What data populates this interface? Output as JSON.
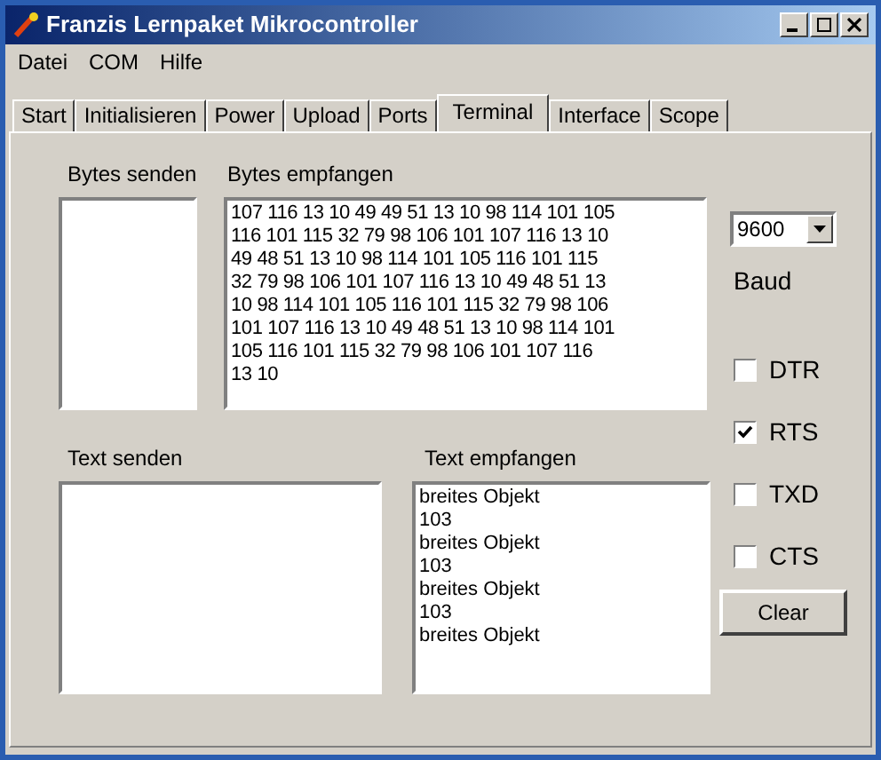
{
  "window": {
    "title": "Franzis Lernpaket Mikrocontroller"
  },
  "menu": [
    "Datei",
    "COM",
    "Hilfe"
  ],
  "tabs": [
    {
      "label": "Start",
      "selected": false
    },
    {
      "label": "Initialisieren",
      "selected": false
    },
    {
      "label": "Power",
      "selected": false
    },
    {
      "label": "Upload",
      "selected": false
    },
    {
      "label": "Ports",
      "selected": false
    },
    {
      "label": "Terminal",
      "selected": true
    },
    {
      "label": "Interface",
      "selected": false
    },
    {
      "label": "Scope",
      "selected": false
    }
  ],
  "bytes_send": {
    "label": "Bytes senden"
  },
  "bytes_received": {
    "label": "Bytes empfangen",
    "lines": [
      "107 116 13 10 49 49 51 13 10 98 114 101 105",
      "116 101 115 32 79 98 106 101 107 116 13 10",
      "49 48 51 13 10 98 114 101 105 116 101 115",
      "32 79 98 106 101 107 116 13 10 49 48 51 13",
      "10 98 114 101 105 116 101 115 32 79 98 106",
      "101 107 116 13 10 49 48 51 13 10 98 114 101",
      "105 116 101 115 32 79 98 106 101 107 116",
      "13 10"
    ]
  },
  "baud": {
    "value": "9600",
    "label": "Baud"
  },
  "signals": [
    {
      "label": "DTR",
      "checked": false
    },
    {
      "label": "RTS",
      "checked": true
    },
    {
      "label": "TXD",
      "checked": false
    },
    {
      "label": "CTS",
      "checked": false
    }
  ],
  "clear_button": "Clear",
  "text_send": {
    "label": "Text senden"
  },
  "text_received": {
    "label": "Text empfangen",
    "lines": [
      "breites Objekt",
      "103",
      "breites Objekt",
      "103",
      "breites Objekt",
      "103",
      "breites Objekt"
    ]
  }
}
